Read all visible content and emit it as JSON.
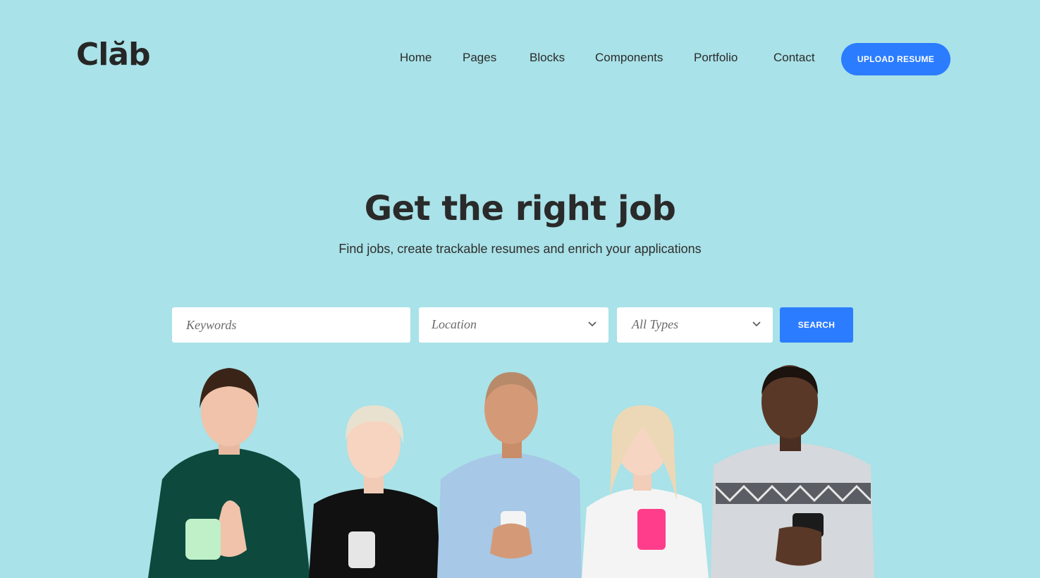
{
  "brand": {
    "logo": "Clăb"
  },
  "nav": {
    "items": [
      "Home",
      "Pages",
      "Blocks",
      "Components",
      "Portfolio",
      "Contact"
    ],
    "cta": "UPLOAD RESUME"
  },
  "hero": {
    "title": "Get the right job",
    "subtitle": "Find jobs, create trackable resumes and enrich your applications"
  },
  "search": {
    "keywords_placeholder": "Keywords",
    "location": "Location",
    "type": "All Types",
    "button": "SEARCH"
  },
  "colors": {
    "background": "#a9e2e8",
    "accent": "#2b7cff"
  }
}
